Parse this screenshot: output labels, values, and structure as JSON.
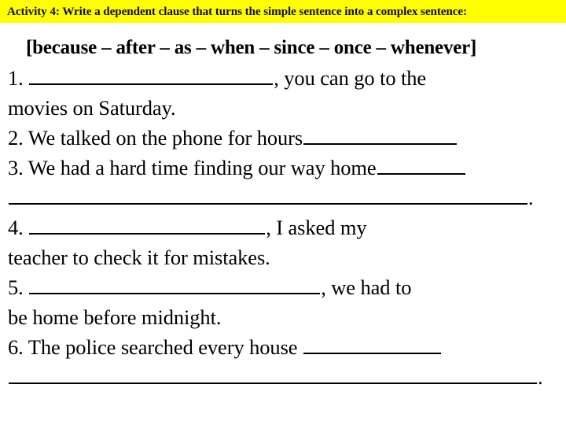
{
  "header": {
    "title": "Activity 4: Write a dependent clause that turns the simple sentence into a complex sentence:",
    "background_color": "#ffff00",
    "text_color": "#0d0d2b"
  },
  "worksheet": {
    "word_bank": "[because – after – as – when – since – once – whenever]",
    "items": [
      {
        "number": "1.",
        "segments_before_blank": "",
        "text_after_blank": ", you can go to the",
        "continuation": "movies on Saturday."
      },
      {
        "number": "2.",
        "text_before_blank": "We talked on the phone for hours",
        "text_after_blank": ""
      },
      {
        "number": "3.",
        "text_before_blank": "We had a hard time finding our way home",
        "text_after_blank": "",
        "continuation_end": "."
      },
      {
        "number": "4.",
        "segments_before_blank": "",
        "text_after_blank": ", I asked my",
        "continuation": "teacher to check it for mistakes."
      },
      {
        "number": "5.",
        "segments_before_blank": "",
        "text_after_blank": ", we had to",
        "continuation": "be home before midnight."
      },
      {
        "number": "6.",
        "text_before_blank": "The police searched every house",
        "text_after_blank": "",
        "continuation_end": "."
      }
    ]
  }
}
